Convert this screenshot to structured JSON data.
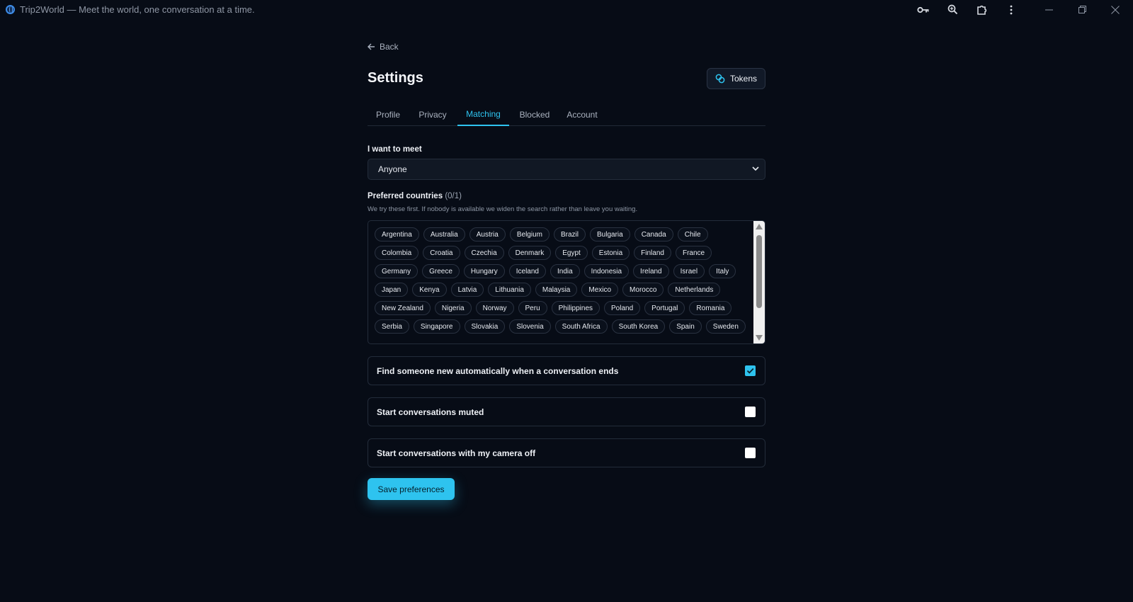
{
  "window": {
    "title": "Trip2World — Meet the world, one conversation at a time."
  },
  "titlebar_icons": [
    "key-icon",
    "zoom-icon",
    "extension-icon",
    "more-vert-icon",
    "minimize-icon",
    "restore-icon",
    "close-icon"
  ],
  "nav": {
    "back_label": "Back"
  },
  "page": {
    "title": "Settings",
    "tokens_label": "Tokens"
  },
  "tabs": [
    {
      "label": "Profile",
      "active": false
    },
    {
      "label": "Privacy",
      "active": false
    },
    {
      "label": "Matching",
      "active": true
    },
    {
      "label": "Blocked",
      "active": false
    },
    {
      "label": "Account",
      "active": false
    }
  ],
  "meet": {
    "label": "I want to meet",
    "selected": "Anyone"
  },
  "countries": {
    "label": "Preferred countries",
    "count": "(0/1)",
    "helper": "We try these first. If nobody is available we widen the search rather than leave you waiting.",
    "items": [
      "Argentina",
      "Australia",
      "Austria",
      "Belgium",
      "Brazil",
      "Bulgaria",
      "Canada",
      "Chile",
      "Colombia",
      "Croatia",
      "Czechia",
      "Denmark",
      "Egypt",
      "Estonia",
      "Finland",
      "France",
      "Germany",
      "Greece",
      "Hungary",
      "Iceland",
      "India",
      "Indonesia",
      "Ireland",
      "Israel",
      "Italy",
      "Japan",
      "Kenya",
      "Latvia",
      "Lithuania",
      "Malaysia",
      "Mexico",
      "Morocco",
      "Netherlands",
      "New Zealand",
      "Nigeria",
      "Norway",
      "Peru",
      "Philippines",
      "Poland",
      "Portugal",
      "Romania",
      "Serbia",
      "Singapore",
      "Slovakia",
      "Slovenia",
      "South Africa",
      "South Korea",
      "Spain",
      "Sweden"
    ]
  },
  "toggles": [
    {
      "label": "Find someone new automatically when a conversation ends",
      "checked": true
    },
    {
      "label": "Start conversations muted",
      "checked": false
    },
    {
      "label": "Start conversations with my camera off",
      "checked": false
    }
  ],
  "actions": {
    "save_label": "Save preferences"
  },
  "colors": {
    "background": "#070c16",
    "accent": "#2ec3ef",
    "border": "#232c3a",
    "muted_text": "#aab2bf"
  }
}
